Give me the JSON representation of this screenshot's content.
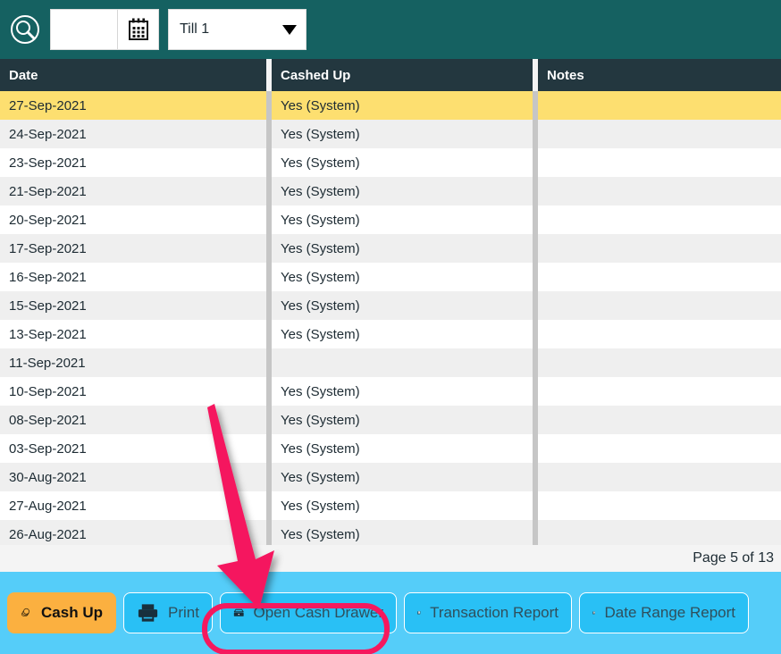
{
  "toolbar": {
    "search_icon": "search-circle-icon",
    "date_value": "",
    "date_placeholder": "",
    "calendar_icon": "calendar-icon",
    "till_selected": "Till 1",
    "till_options": [
      "Till 1"
    ],
    "dropdown_icon": "chevron-down-icon"
  },
  "table": {
    "columns": [
      "Date",
      "Cashed Up",
      "Notes"
    ],
    "rows": [
      {
        "date": "27-Sep-2021",
        "cashed_up": "Yes (System)",
        "notes": "",
        "selected": true
      },
      {
        "date": "24-Sep-2021",
        "cashed_up": "Yes (System)",
        "notes": "",
        "selected": false
      },
      {
        "date": "23-Sep-2021",
        "cashed_up": "Yes (System)",
        "notes": "",
        "selected": false
      },
      {
        "date": "21-Sep-2021",
        "cashed_up": "Yes (System)",
        "notes": "",
        "selected": false
      },
      {
        "date": "20-Sep-2021",
        "cashed_up": "Yes (System)",
        "notes": "",
        "selected": false
      },
      {
        "date": "17-Sep-2021",
        "cashed_up": "Yes (System)",
        "notes": "",
        "selected": false
      },
      {
        "date": "16-Sep-2021",
        "cashed_up": "Yes (System)",
        "notes": "",
        "selected": false
      },
      {
        "date": "15-Sep-2021",
        "cashed_up": "Yes (System)",
        "notes": "",
        "selected": false
      },
      {
        "date": "13-Sep-2021",
        "cashed_up": "Yes (System)",
        "notes": "",
        "selected": false
      },
      {
        "date": "11-Sep-2021",
        "cashed_up": "",
        "notes": "",
        "selected": false
      },
      {
        "date": "10-Sep-2021",
        "cashed_up": "Yes (System)",
        "notes": "",
        "selected": false
      },
      {
        "date": "08-Sep-2021",
        "cashed_up": "Yes (System)",
        "notes": "",
        "selected": false
      },
      {
        "date": "03-Sep-2021",
        "cashed_up": "Yes (System)",
        "notes": "",
        "selected": false
      },
      {
        "date": "30-Aug-2021",
        "cashed_up": "Yes (System)",
        "notes": "",
        "selected": false
      },
      {
        "date": "27-Aug-2021",
        "cashed_up": "Yes (System)",
        "notes": "",
        "selected": false
      },
      {
        "date": "26-Aug-2021",
        "cashed_up": "Yes (System)",
        "notes": "",
        "selected": false
      }
    ]
  },
  "pagination": {
    "text": "Page 5 of 13",
    "current_page": 5,
    "total_pages": 13
  },
  "buttons": [
    {
      "label": "Cash Up",
      "icon": "coins-icon"
    },
    {
      "label": "Print",
      "icon": "printer-icon"
    },
    {
      "label": "Open Cash Drawer",
      "icon": "cash-drawer-icon",
      "highlighted": true
    },
    {
      "label": "Transaction Report",
      "icon": "report-chart-icon"
    },
    {
      "label": "Date Range Report",
      "icon": "report-chart-icon"
    }
  ],
  "annotation": {
    "arrow_icon": "pointer-arrow-icon",
    "points_to": "Open Cash Drawer"
  },
  "colors": {
    "toolbar_teal": "#156161",
    "header_navy": "#23373f",
    "row_selected": "#fddf70",
    "row_alt": "#efefef",
    "bar_blue": "#55cdf9",
    "button_blue": "#29c0f5",
    "cashup_orange": "#fbb040",
    "highlight_pink": "#f5195e"
  }
}
